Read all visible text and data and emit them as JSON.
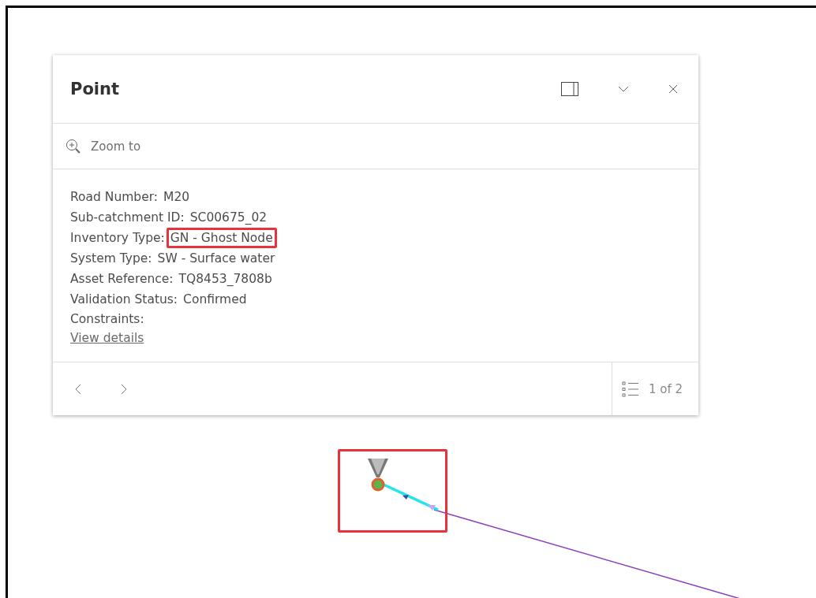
{
  "popup": {
    "title": "Point",
    "zoom_action": "Zoom to",
    "fields": [
      {
        "label": "Road Number:",
        "value": "M20",
        "highlighted": false
      },
      {
        "label": "Sub-catchment ID:",
        "value": "SC00675_02",
        "highlighted": false
      },
      {
        "label": "Inventory Type:",
        "value": "GN - Ghost Node",
        "highlighted": true
      },
      {
        "label": "System Type:",
        "value": "SW - Surface water",
        "highlighted": false
      },
      {
        "label": "Asset Reference:",
        "value": "TQ8453_7808b",
        "highlighted": false
      },
      {
        "label": "Validation Status:",
        "value": "Confirmed",
        "highlighted": false
      },
      {
        "label": "Constraints:"
      }
    ],
    "link": "View details",
    "page_count": "1 of 2"
  },
  "map": {
    "marker_highlighted": true
  }
}
